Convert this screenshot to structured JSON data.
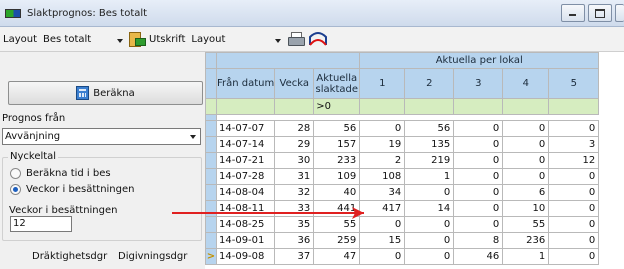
{
  "window": {
    "title": "Slaktprognos: Bes totalt"
  },
  "toolbar": {
    "layout_label": "Layout",
    "layout_value": "Bes totalt",
    "utskrift_label": "Utskrift",
    "utskrift_layout_value": "Layout",
    "icons": [
      "excel-export-icon",
      "printer-icon",
      "chart-icon"
    ]
  },
  "left": {
    "calc_button": "Beräkna",
    "prognos_label": "Prognos från",
    "prognos_value": "Avvänjning",
    "nyckeltal_label": "Nyckeltal",
    "radio1": "Beräkna tid i bes",
    "radio2": "Veckor i besättningen",
    "weeks_label": "Veckor i besättningen",
    "weeks_value": "12",
    "draktighet_label": "Dräktighetsdgr",
    "digivning_label": "Digivningsdgr"
  },
  "grid": {
    "group_header": "Aktuella per lokal",
    "columns": [
      "Från datum",
      "Vecka",
      "Aktuella slaktade",
      "1",
      "2",
      "3",
      "4",
      "5"
    ],
    "filter": ">0",
    "current_row_marker": ">",
    "rows": [
      [
        "14-07-07",
        "28",
        "56",
        "0",
        "56",
        "0",
        "0",
        "0"
      ],
      [
        "14-07-14",
        "29",
        "157",
        "19",
        "135",
        "0",
        "0",
        "3"
      ],
      [
        "14-07-21",
        "30",
        "233",
        "2",
        "219",
        "0",
        "0",
        "12"
      ],
      [
        "14-07-28",
        "31",
        "109",
        "108",
        "1",
        "0",
        "0",
        "0"
      ],
      [
        "14-08-04",
        "32",
        "40",
        "34",
        "0",
        "0",
        "6",
        "0"
      ],
      [
        "14-08-11",
        "33",
        "441",
        "417",
        "14",
        "0",
        "10",
        "0"
      ],
      [
        "14-08-25",
        "35",
        "55",
        "0",
        "0",
        "0",
        "55",
        "0"
      ],
      [
        "14-09-01",
        "36",
        "259",
        "15",
        "0",
        "8",
        "236",
        "0"
      ],
      [
        "14-09-08",
        "37",
        "47",
        "0",
        "0",
        "46",
        "1",
        "0"
      ]
    ]
  },
  "colors": {
    "header": "#b7d4ee",
    "filter_row": "#d6edc0",
    "annotation": "#e02020"
  }
}
